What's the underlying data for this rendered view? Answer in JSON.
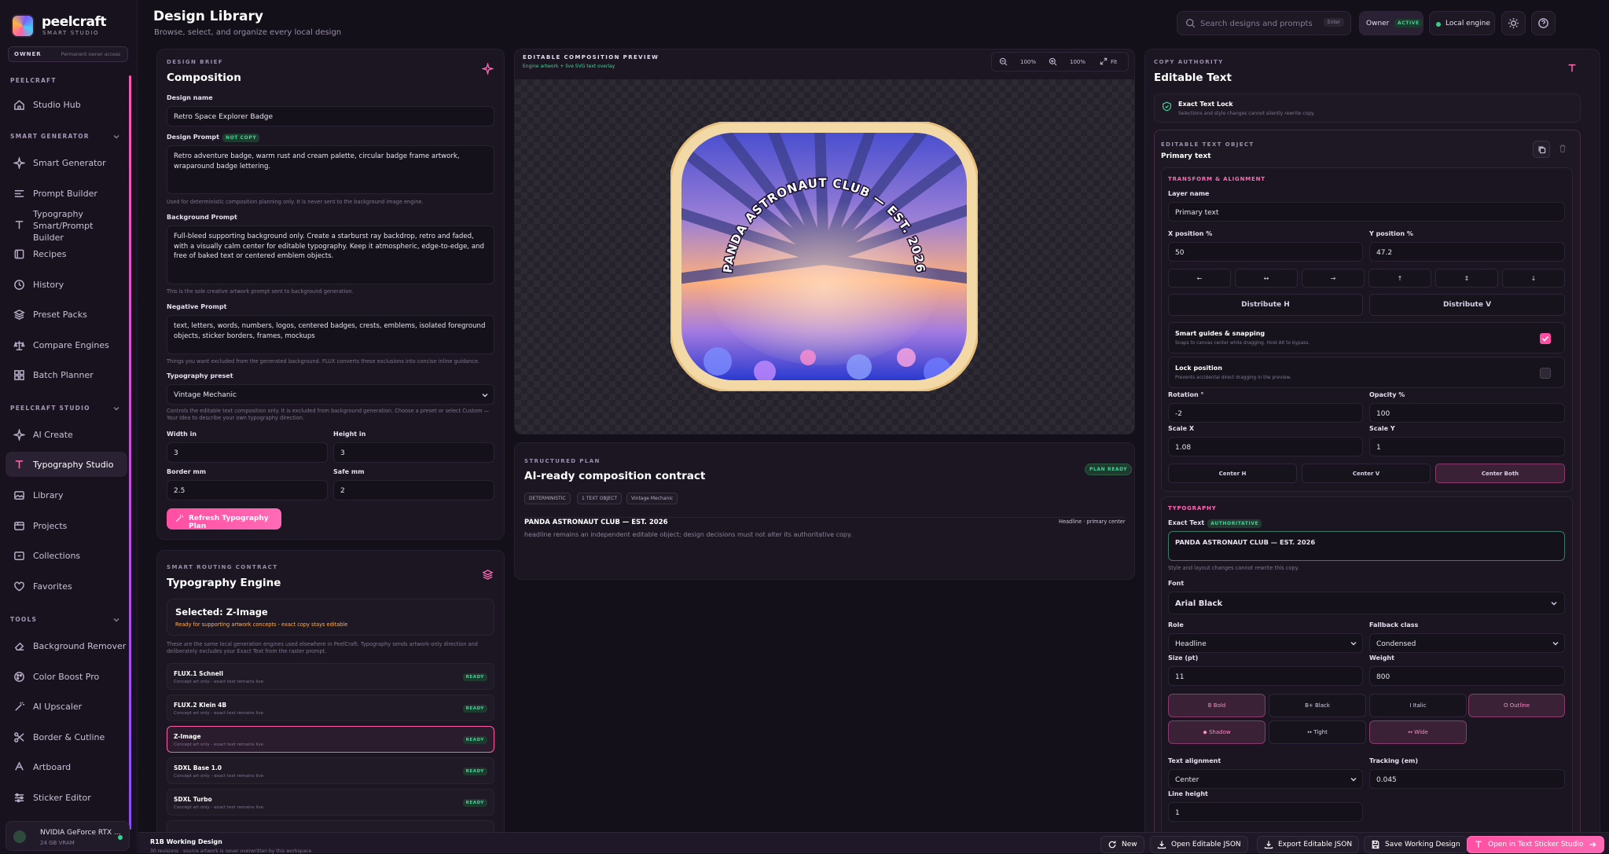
{
  "app": {
    "brand": "peelcraft",
    "brand_sub": "SMART STUDIO",
    "owner_label": "OWNER",
    "owner_note": "Permanent owner access"
  },
  "sidebar": {
    "sections": [
      {
        "label": "PEELCRAFT"
      },
      {
        "label": "SMART GENERATOR"
      },
      {
        "label": "PEELCRAFT STUDIO"
      },
      {
        "label": "TOOLS"
      }
    ],
    "items": [
      {
        "label": "Studio Hub",
        "icon": "home-icon"
      },
      {
        "label": "Smart Generator",
        "icon": "sparkle-icon"
      },
      {
        "label": "Prompt Builder",
        "icon": "list-icon"
      },
      {
        "label": "Typography Smart/Prompt Builder",
        "icon": "text-icon"
      },
      {
        "label": "Recipes",
        "icon": "book-icon"
      },
      {
        "label": "History",
        "icon": "clock-icon"
      },
      {
        "label": "Preset Packs",
        "icon": "layers-icon"
      },
      {
        "label": "Compare Engines",
        "icon": "scale-icon"
      },
      {
        "label": "Batch Planner",
        "icon": "grid-icon"
      },
      {
        "label": "AI Create",
        "icon": "sparkle-icon"
      },
      {
        "label": "Typography Studio",
        "icon": "text-icon"
      },
      {
        "label": "Library",
        "icon": "image-icon"
      },
      {
        "label": "Projects",
        "icon": "folder-icon"
      },
      {
        "label": "Collections",
        "icon": "collection-icon"
      },
      {
        "label": "Favorites",
        "icon": "heart-icon"
      },
      {
        "label": "Background Remover",
        "icon": "eraser-icon"
      },
      {
        "label": "Color Boost Pro",
        "icon": "palette-icon"
      },
      {
        "label": "AI Upscaler",
        "icon": "wand-icon"
      },
      {
        "label": "Border & Cutline",
        "icon": "scissors-icon"
      },
      {
        "label": "Artboard",
        "icon": "artboard-icon"
      },
      {
        "label": "Sticker Editor",
        "icon": "sliders-icon"
      }
    ],
    "gpu_name": "NVIDIA GeForce RTX ...",
    "gpu_vram": "24 GB VRAM"
  },
  "header": {
    "title": "Design Library",
    "subtitle": "Browse, select, and organize every local design",
    "search_placeholder": "Search designs and prompts",
    "search_kbd": "Enter",
    "owner": "Owner",
    "owner_status": "ACTIVE",
    "engine": "Local engine"
  },
  "brief": {
    "kicker": "DESIGN BRIEF",
    "title": "Composition",
    "name_label": "Design name",
    "name_value": "Retro Space Explorer Badge",
    "prompt_label": "Design Prompt",
    "prompt_tag": "NOT COPY",
    "prompt_value": "Retro adventure badge, warm rust and cream palette, circular badge frame artwork, wraparound badge lettering.",
    "prompt_help": "Used for deterministic composition planning only. It is never sent to the background image engine.",
    "bg_label": "Background Prompt",
    "bg_value": "Full-bleed supporting background only. Create a starburst ray backdrop, retro and faded, with a visually calm center for editable typography. Keep it atmospheric, edge-to-edge, and free of baked text or centered emblem objects.",
    "bg_help": "This is the sole creative artwork prompt sent to background generation.",
    "neg_label": "Negative Prompt",
    "neg_value": "text, letters, words, numbers, logos, centered badges, crests, emblems, isolated foreground objects, sticker borders, frames, mockups",
    "neg_help": "Things you want excluded from the generated background. FLUX converts these exclusions into concise inline guidance.",
    "typo_label": "Typography preset",
    "typo_value": "Vintage Mechanic",
    "typo_help": "Controls the editable text composition only. It is excluded from background generation. Choose a preset or select Custom — Your Idea to describe your own typography direction.",
    "width_label": "Width in",
    "width_value": "3",
    "height_label": "Height in",
    "height_value": "3",
    "border_label": "Border mm",
    "border_value": "2.5",
    "safe_label": "Safe mm",
    "safe_value": "2",
    "refresh_button": "Refresh Typography Plan"
  },
  "routing": {
    "kicker": "SMART ROUTING CONTRACT",
    "title": "Typography Engine",
    "selected": "Selected: Z-Image",
    "selected_note": "Ready for supporting artwork concepts - exact copy stays editable",
    "help": "These are the same local generation engines used elsewhere in PeelCraft. Typography sends artwork-only direction and deliberately excludes your Exact Text from the raster prompt.",
    "engines": [
      {
        "name": "FLUX.1 Schnell",
        "note": "Concept art only - exact text remains live",
        "status": "READY"
      },
      {
        "name": "FLUX.2 Klein 4B",
        "note": "Concept art only - exact text remains live",
        "status": "READY"
      },
      {
        "name": "Z-Image",
        "note": "Concept art only - exact text remains live",
        "status": "READY"
      },
      {
        "name": "SDXL Base 1.0",
        "note": "Concept art only - exact text remains live",
        "status": "READY"
      },
      {
        "name": "SDXL Turbo",
        "note": "Concept art only - exact text remains live",
        "status": "READY"
      }
    ]
  },
  "preview": {
    "kicker": "EDITABLE COMPOSITION PREVIEW",
    "sub": "Engine artwork + live SVG text overlay",
    "zoom1": "100%",
    "zoom2": "100%",
    "fit": "Fit",
    "badge_text": "PANDA ASTRONAUT CLUB — EST. 2026"
  },
  "plan": {
    "kicker": "STRUCTURED PLAN",
    "title": "AI-ready composition contract",
    "status": "PLAN READY",
    "chips": [
      "DETERMINISTIC",
      "1 TEXT OBJECT",
      "Vintage Mechanic"
    ],
    "line_title": "PANDA ASTRONAUT CLUB — EST. 2026",
    "line_meta": "Headline · primary center",
    "line_note": "headline remains an independent editable object; design decisions must not alter its authoritative copy."
  },
  "copy": {
    "kicker": "COPY AUTHORITY",
    "title": "Editable Text",
    "lock_title": "Exact Text Lock",
    "lock_note": "Selections and style changes cannot silently rewrite copy.",
    "obj_kicker": "EDITABLE TEXT OBJECT",
    "obj_title": "Primary text",
    "transform_kicker": "TRANSFORM & ALIGNMENT",
    "layer_label": "Layer name",
    "layer_value": "Primary text",
    "x_label": "X position %",
    "x_value": "50",
    "y_label": "Y position %",
    "y_value": "47.2",
    "align_buttons": [
      "←",
      "↔",
      "→",
      "↑",
      "↕",
      "↓"
    ],
    "distribute_h": "Distribute H",
    "distribute_v": "Distribute V",
    "guides_title": "Smart guides & snapping",
    "guides_note": "Snaps to canvas center while dragging. Hold Alt to bypass.",
    "lock_pos_title": "Lock position",
    "lock_pos_note": "Prevents accidental direct dragging in the preview.",
    "rotation_label": "Rotation °",
    "rotation_value": "-2",
    "opacity_label": "Opacity %",
    "opacity_value": "100",
    "scalex_label": "Scale X",
    "scalex_value": "1.08",
    "scaley_label": "Scale Y",
    "scaley_value": "1",
    "center_h": "Center H",
    "center_v": "Center V",
    "center_both": "Center Both",
    "typo_kicker": "TYPOGRAPHY",
    "exact_label": "Exact Text",
    "exact_tag": "AUTHORITATIVE",
    "exact_value": "PANDA ASTRONAUT CLUB — EST. 2026",
    "exact_help": "Style and layout changes cannot rewrite this copy.",
    "font_label": "Font",
    "font_value": "Arial Black",
    "role_label": "Role",
    "role_value": "Headline",
    "fallback_label": "Fallback class",
    "fallback_value": "Condensed",
    "size_label": "Size (pt)",
    "size_value": "11",
    "weight_label": "Weight",
    "weight_value": "800",
    "style_buttons": [
      "B  Bold",
      "B+  Black",
      "I  Italic",
      "O  Outline",
      "◆  Shadow",
      "↔  Tight",
      "↔  Wide"
    ],
    "align_label": "Text alignment",
    "align_value": "Center",
    "tracking_label": "Tracking (em)",
    "tracking_value": "0.045",
    "lh_label": "Line height",
    "lh_value": "1"
  },
  "bottom": {
    "title": "R1B Working Design",
    "sub": "30 revisions · source artwork is never overwritten by this workspace",
    "new": "New",
    "open": "Open Editable JSON",
    "export": "Export Editable JSON",
    "save": "Save Working Design",
    "open_sticker": "Open in Text Sticker Studio"
  },
  "colors": {
    "accent": "#ff4fa3",
    "ready": "#44d19a",
    "badge_ring": "#f3d9a5"
  }
}
